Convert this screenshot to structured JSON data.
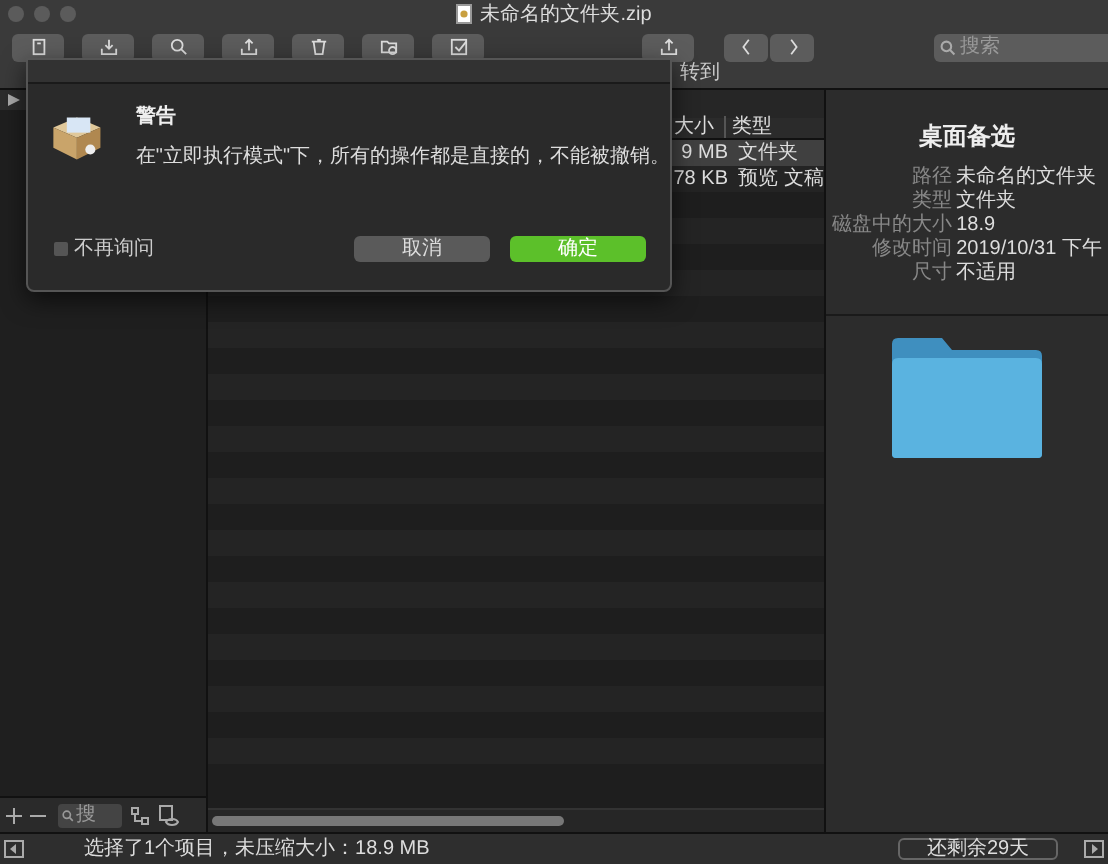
{
  "window": {
    "title": "未命名的文件夹.zip"
  },
  "toolbar": {
    "goto_label": "转到",
    "search": {
      "placeholder": "搜索"
    }
  },
  "sidebar": {
    "search": {
      "placeholder": "搜"
    }
  },
  "table": {
    "columns": [
      "大小",
      "类型"
    ],
    "rows": [
      {
        "size": "9 MB",
        "type": "文件夹",
        "selected": true
      },
      {
        "size": "78 KB",
        "type": "预览 文稿",
        "selected": false
      }
    ]
  },
  "inspector": {
    "title": "桌面备选",
    "fields": [
      {
        "label": "路径",
        "value": "未命名的文件夹"
      },
      {
        "label": "类型",
        "value": "文件夹"
      },
      {
        "label": "磁盘中的大小",
        "value": "18.9"
      },
      {
        "label": "修改时间",
        "value": "2019/10/31 下午"
      },
      {
        "label": "尺寸",
        "value": "不适用"
      }
    ]
  },
  "dialog": {
    "title": "警告",
    "message": "在\"立即执行模式\"下，所有的操作都是直接的，不能被撤销。",
    "checkbox": {
      "label": "不再询问",
      "checked": false
    },
    "buttons": [
      {
        "label": "取消",
        "kind": "secondary"
      },
      {
        "label": "确定",
        "kind": "primary"
      }
    ]
  },
  "status_bar": {
    "text": "选择了1个项目，未压缩大小：18.9 MB",
    "trial": "还剩余29天"
  }
}
